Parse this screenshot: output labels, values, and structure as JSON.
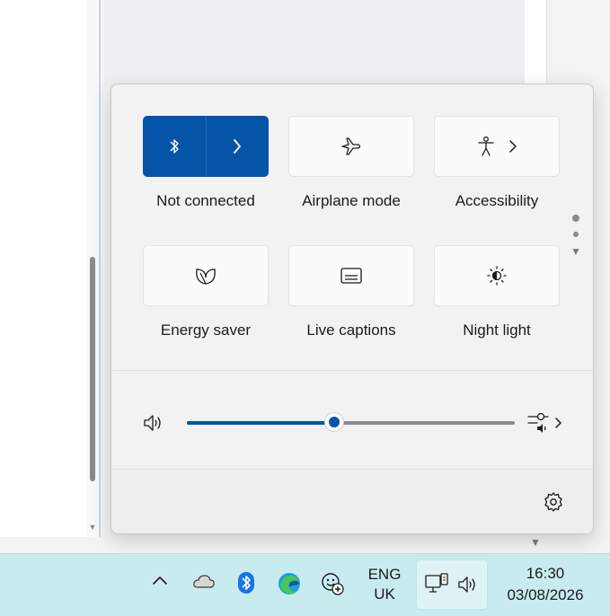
{
  "quick_settings": {
    "tiles": [
      {
        "id": "bluetooth",
        "label": "Not connected",
        "icon": "bluetooth-icon",
        "active": true,
        "expandable": true
      },
      {
        "id": "airplane",
        "label": "Airplane mode",
        "icon": "airplane-icon",
        "active": false
      },
      {
        "id": "accessibility",
        "label": "Accessibility",
        "icon": "accessibility-icon",
        "active": false,
        "expandable": true
      },
      {
        "id": "energy",
        "label": "Energy saver",
        "icon": "leaf-icon",
        "active": false
      },
      {
        "id": "captions",
        "label": "Live captions",
        "icon": "captions-icon",
        "active": false
      },
      {
        "id": "nightlight",
        "label": "Night light",
        "icon": "brightness-icon",
        "active": false
      }
    ],
    "pages": {
      "count": 2,
      "current": 1
    },
    "volume": {
      "icon": "speaker-icon",
      "level": 0.45,
      "output_icon": "audio-output-icon"
    },
    "settings_icon": "gear-icon"
  },
  "taskbar": {
    "tray_icons": [
      "chevron-up-icon",
      "onedrive-icon",
      "bluetooth-icon",
      "edge-icon",
      "copilot-icon"
    ],
    "language": {
      "line1": "ENG",
      "line2": "UK"
    },
    "system_icons": [
      "network-icon",
      "volume-icon"
    ],
    "clock": {
      "time": "16:30",
      "date": "03/08/2026"
    }
  },
  "colors": {
    "accent": "#0554a8",
    "taskbar": "#c8ebf0"
  }
}
